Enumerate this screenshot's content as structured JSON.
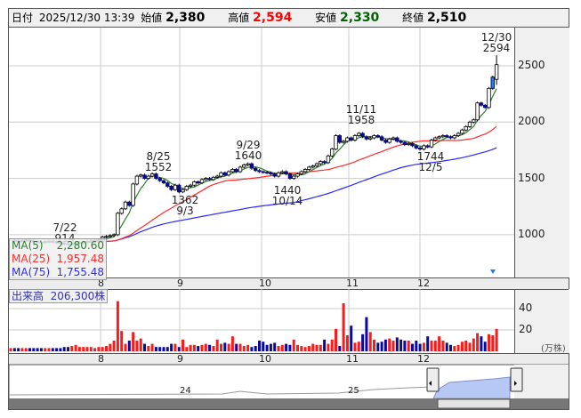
{
  "header": {
    "date_label": "日付",
    "datetime": "2025/12/30 13:39",
    "open_label": "始値",
    "open": "2,380",
    "high_label": "高値",
    "high": "2,594",
    "low_label": "安値",
    "low": "2,330",
    "close_label": "終値",
    "close": "2,510"
  },
  "colors": {
    "up": "#ffffff",
    "down": "#0a0a8c",
    "ma5": "#2e7d2e",
    "ma25": "#ff2a2a",
    "ma75": "#2a2aff",
    "vol_up": "#ff1a1a",
    "vol_down": "#0a0a9c",
    "high_text": "#ff0000",
    "low_text": "#006400"
  },
  "legend": {
    "ma5_label": "MA(5)",
    "ma5_value": "2,280.60",
    "ma25_label": "MA(25)",
    "ma25_value": "1,957.48",
    "ma75_label": "MA(75)",
    "ma75_value": "1,755.48"
  },
  "volume_legend": {
    "label": "出来高",
    "value": "206,300株"
  },
  "annotations": [
    {
      "date": "7/22",
      "price": "914"
    },
    {
      "date": "8/25",
      "price": "1552"
    },
    {
      "date": "9/3",
      "price": "1362"
    },
    {
      "date": "9/29",
      "price": "1640"
    },
    {
      "date": "10/14",
      "price": "1440"
    },
    {
      "date": "11/11",
      "price": "1958"
    },
    {
      "date": "12/5",
      "price": "1744"
    },
    {
      "date": "12/30",
      "price": "2594"
    }
  ],
  "chart_data": {
    "type": "candlestick",
    "price_ticks": [
      "2500",
      "2000",
      "1500",
      "1000"
    ],
    "month_ticks": [
      "8",
      "9",
      "10",
      "11",
      "12"
    ],
    "volume_ticks": [
      "40",
      "20"
    ],
    "volume_unit": "(万株)",
    "navigator_ticks": [
      "24",
      "25"
    ],
    "close": [
      950,
      945,
      940,
      948,
      952,
      945,
      940,
      935,
      930,
      938,
      942,
      936,
      930,
      925,
      918,
      916,
      920,
      925,
      930,
      935,
      940,
      945,
      950,
      955,
      980,
      985,
      992,
      1000,
      1190,
      1230,
      1290,
      1260,
      1450,
      1520,
      1530,
      1500,
      1520,
      1540,
      1500,
      1480,
      1460,
      1430,
      1400,
      1440,
      1380,
      1400,
      1430,
      1440,
      1470,
      1460,
      1490,
      1500,
      1490,
      1510,
      1520,
      1550,
      1530,
      1560,
      1580,
      1560,
      1600,
      1620,
      1630,
      1590,
      1570,
      1560,
      1555,
      1550,
      1540,
      1520,
      1550,
      1560,
      1540,
      1500,
      1520,
      1540,
      1560,
      1580,
      1600,
      1610,
      1630,
      1650,
      1640,
      1700,
      1760,
      1880,
      1820,
      1830,
      1860,
      1840,
      1880,
      1900,
      1870,
      1850,
      1860,
      1880,
      1870,
      1840,
      1820,
      1850,
      1860,
      1830,
      1820,
      1800,
      1810,
      1790,
      1770,
      1760,
      1790,
      1780,
      1840,
      1860,
      1870,
      1880,
      1870,
      1860,
      1880,
      1900,
      1930,
      1960,
      2000,
      2020,
      2170,
      2150,
      2130,
      2300,
      2400,
      2510
    ],
    "last_bar": {
      "open": 2380,
      "high": 2594,
      "low": 2330,
      "close": 2510
    },
    "volume": [
      3,
      3,
      3,
      3,
      3,
      3,
      3,
      3,
      3,
      3,
      3,
      3,
      3,
      3,
      4,
      4,
      5,
      6,
      4,
      4,
      4,
      4,
      3,
      4,
      4,
      5,
      7,
      10,
      47,
      19,
      7,
      10,
      18,
      10,
      12,
      7,
      5,
      7,
      4,
      4,
      4,
      4,
      7,
      7,
      4,
      11,
      4,
      6,
      6,
      5,
      6,
      7,
      6,
      5,
      11,
      7,
      8,
      7,
      14,
      7,
      7,
      5,
      6,
      4,
      5,
      10,
      9,
      6,
      7,
      8,
      5,
      6,
      7,
      6,
      11,
      6,
      5,
      4,
      5,
      7,
      6,
      6,
      11,
      7,
      11,
      21,
      5,
      45,
      15,
      24,
      8,
      9,
      16,
      32,
      18,
      11,
      8,
      9,
      11,
      12,
      10,
      13,
      11,
      10,
      10,
      7,
      10,
      7,
      8,
      14,
      10,
      10,
      14,
      10,
      8,
      6,
      5,
      6,
      9,
      10,
      8,
      12,
      17,
      14,
      9,
      16,
      15,
      21
    ],
    "price_range": [
      800,
      2800
    ],
    "volume_range": [
      0,
      60
    ]
  }
}
